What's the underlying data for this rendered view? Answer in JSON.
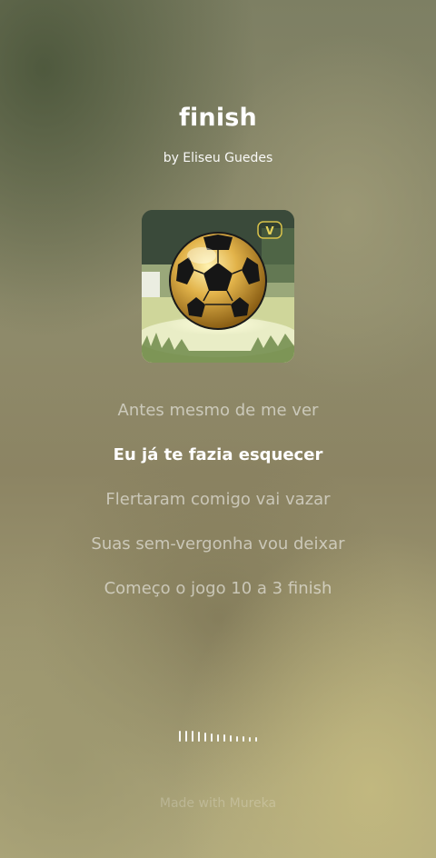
{
  "song": {
    "title": "finish",
    "artist": "by Eliseu Guedes"
  },
  "cover": {
    "badge": "V"
  },
  "lyrics": [
    {
      "text": "Antes mesmo de me ver",
      "active": false
    },
    {
      "text": "Eu já te fazia esquecer",
      "active": true
    },
    {
      "text": "Flertaram comigo vai vazar",
      "active": false
    },
    {
      "text": "Suas sem-vergonha vou deixar",
      "active": false
    },
    {
      "text": "Começo o jogo 10 a 3 finish",
      "active": false
    }
  ],
  "footer": {
    "watermark": "Made with Mureka"
  }
}
